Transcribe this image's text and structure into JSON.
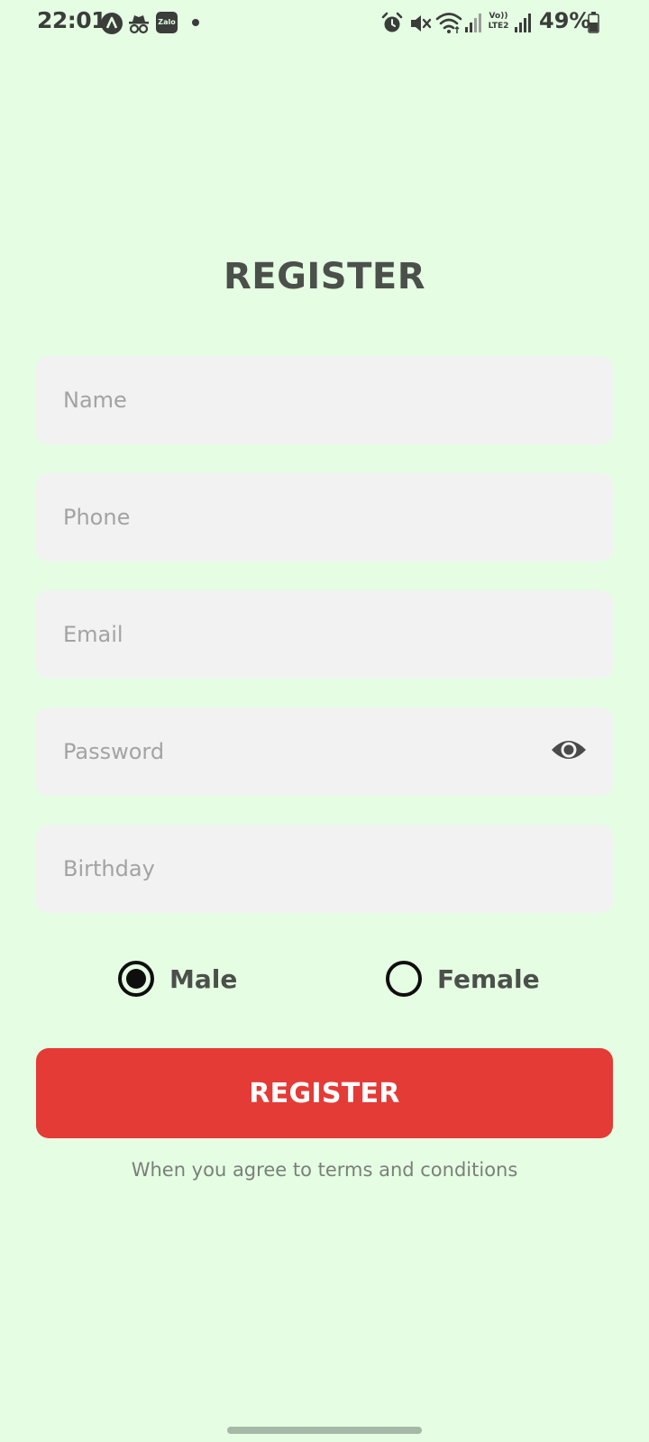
{
  "status_bar": {
    "time": "22:01",
    "battery": "49%",
    "left_icons": [
      "navigation-app-icon",
      "incognito-icon",
      "zalo-icon",
      "notification-dot-icon"
    ],
    "right_icons": [
      "alarm-icon",
      "mute-icon",
      "wifi-icon",
      "signal-icon",
      "volte-icon",
      "signal-icon",
      "battery-icon"
    ],
    "zalo_label": "Zalo",
    "volte_label": "Vo)) LTE2"
  },
  "form": {
    "title": "REGISTER",
    "name_placeholder": "Name",
    "phone_placeholder": "Phone",
    "email_placeholder": "Email",
    "password_placeholder": "Password",
    "birthday_placeholder": "Birthday",
    "gender": {
      "options": [
        "Male",
        "Female"
      ],
      "selected": "Male"
    },
    "submit_label": "REGISTER",
    "terms_text": "When you agree to terms and conditions"
  },
  "colors": {
    "background": "#e5fde3",
    "field_bg": "#f2f2f2",
    "button": "#e43b37",
    "title_text": "#4b504b",
    "placeholder": "#a3a3a3"
  }
}
